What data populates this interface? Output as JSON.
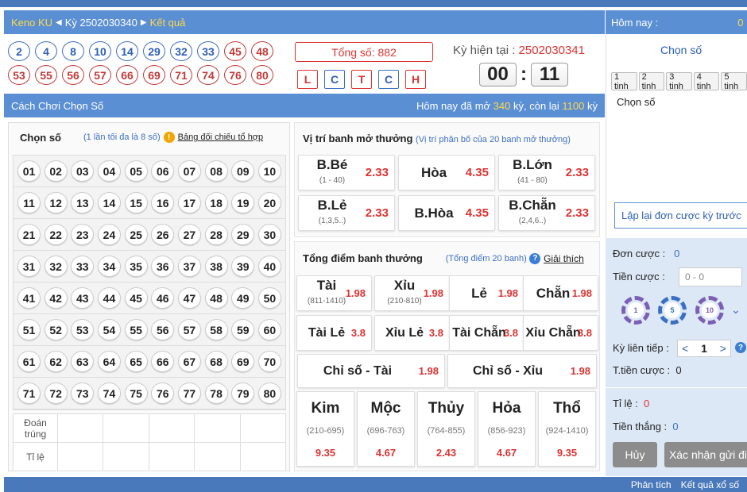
{
  "header": {
    "game": "Keno KU",
    "period_label": "Kỳ",
    "period": "2502030340",
    "results": "Kết quả"
  },
  "right_header": {
    "today": "Hôm nay :",
    "value": "0"
  },
  "results": {
    "row1": [
      "2",
      "4",
      "8",
      "10",
      "14",
      "29",
      "32",
      "33",
      "45",
      "48"
    ],
    "row2": [
      "53",
      "55",
      "56",
      "57",
      "66",
      "69",
      "71",
      "74",
      "76",
      "80"
    ],
    "row1_red_from": 8
  },
  "total": "Tổng số: 882",
  "flags": [
    {
      "t": "L",
      "c": "red"
    },
    {
      "t": "C",
      "c": "blue"
    },
    {
      "t": "T",
      "c": "red"
    },
    {
      "t": "C",
      "c": "blue"
    },
    {
      "t": "H",
      "c": "red"
    }
  ],
  "current": {
    "label": "Kỳ hiện tại : ",
    "value": "2502030341"
  },
  "clock": {
    "min": "00",
    "sec": "11"
  },
  "bar2": {
    "left": "Cách Chơi Chọn Số",
    "pre": "Hôm nay đã mở ",
    "opened": "340",
    "mid": " kỳ, còn lại ",
    "remain": "1100",
    "post": " kỳ"
  },
  "pick": {
    "title": "Chọn số",
    "note": "(1 lần tối đa là 8 số)",
    "compare": "Bảng đối chiếu tổ hợp"
  },
  "numbers": [
    "01",
    "02",
    "03",
    "04",
    "05",
    "06",
    "07",
    "08",
    "09",
    "10",
    "11",
    "12",
    "13",
    "14",
    "15",
    "16",
    "17",
    "18",
    "19",
    "20",
    "21",
    "22",
    "23",
    "24",
    "25",
    "26",
    "27",
    "28",
    "29",
    "30",
    "31",
    "32",
    "33",
    "34",
    "35",
    "36",
    "37",
    "38",
    "39",
    "40",
    "41",
    "42",
    "43",
    "44",
    "45",
    "46",
    "47",
    "48",
    "49",
    "50",
    "51",
    "52",
    "53",
    "54",
    "55",
    "56",
    "57",
    "58",
    "59",
    "60",
    "61",
    "62",
    "63",
    "64",
    "65",
    "66",
    "67",
    "68",
    "69",
    "70",
    "71",
    "72",
    "73",
    "74",
    "75",
    "76",
    "77",
    "78",
    "79",
    "80"
  ],
  "table": {
    "row1": "Đoán trúng",
    "row2": "Tỉ lệ"
  },
  "pos": {
    "title": "Vị trí banh mở thưởng",
    "note": "(Vị trí phân bố của 20 banh mở thưởng)",
    "cells": [
      {
        "n": "B.Bé",
        "s": "(1 - 40)",
        "o": "2.33"
      },
      {
        "n": "Hòa",
        "s": "",
        "o": "4.35"
      },
      {
        "n": "B.Lớn",
        "s": "(41 - 80)",
        "o": "2.33"
      },
      {
        "n": "B.Lẻ",
        "s": "(1,3,5..)",
        "o": "2.33"
      },
      {
        "n": "B.Hòa",
        "s": "",
        "o": "4.35"
      },
      {
        "n": "B.Chẵn",
        "s": "(2,4,6..)",
        "o": "2.33"
      }
    ]
  },
  "sum": {
    "title": "Tổng điểm banh thưởng",
    "note": "(Tổng điểm 20 banh)",
    "explain": "Giải thích",
    "row1": [
      {
        "n": "Tài",
        "s": "(811-1410)",
        "o": "1.98"
      },
      {
        "n": "Xỉu",
        "s": "(210-810)",
        "o": "1.98"
      },
      {
        "n": "Lẻ",
        "s": "",
        "o": "1.98"
      },
      {
        "n": "Chẵn",
        "s": "",
        "o": "1.98"
      }
    ],
    "row2": [
      {
        "n": "Tài Lẻ",
        "o": "3.8"
      },
      {
        "n": "Xỉu Lẻ",
        "o": "3.8"
      },
      {
        "n": "Tài Chẵn",
        "o": "3.8"
      },
      {
        "n": "Xỉu Chẵn",
        "o": "3.8"
      }
    ],
    "row3": [
      {
        "n": "Chỉ số - Tài",
        "o": "1.98"
      },
      {
        "n": "Chỉ số - Xỉu",
        "o": "1.98"
      }
    ],
    "elems": [
      {
        "n": "Kim",
        "r": "(210-695)",
        "o": "9.35"
      },
      {
        "n": "Mộc",
        "r": "(696-763)",
        "o": "4.67"
      },
      {
        "n": "Thủy",
        "r": "(764-855)",
        "o": "2.43"
      },
      {
        "n": "Hỏa",
        "r": "(856-923)",
        "o": "4.67"
      },
      {
        "n": "Thổ",
        "r": "(924-1410)",
        "o": "9.35"
      }
    ]
  },
  "side": {
    "choose": "Chọn số",
    "tabs": [
      "1 tinh",
      "2 tinh",
      "3 tinh",
      "4 tinh",
      "5 tinh"
    ],
    "choose2": "Chọn số",
    "repeat": "Lập lại đơn cược kỳ trước"
  },
  "bet": {
    "order": "Đơn cược :",
    "order_v": "0",
    "amount": "Tiền cược :",
    "amount_ph": "0 - 0",
    "chips": [
      "1",
      "5",
      "10"
    ],
    "consec": "Kỳ liên tiếp :",
    "consec_v": "1",
    "total": "T.tiền cược :",
    "total_v": "0",
    "rate": "Tỉ lệ :",
    "rate_v": "0",
    "win": "Tiền thắng :",
    "win_v": "0",
    "cancel": "Hủy",
    "confirm": "Xác nhận gửi đi"
  },
  "bottom": {
    "a": "Phân tích",
    "b": "Kết quả xổ số"
  }
}
